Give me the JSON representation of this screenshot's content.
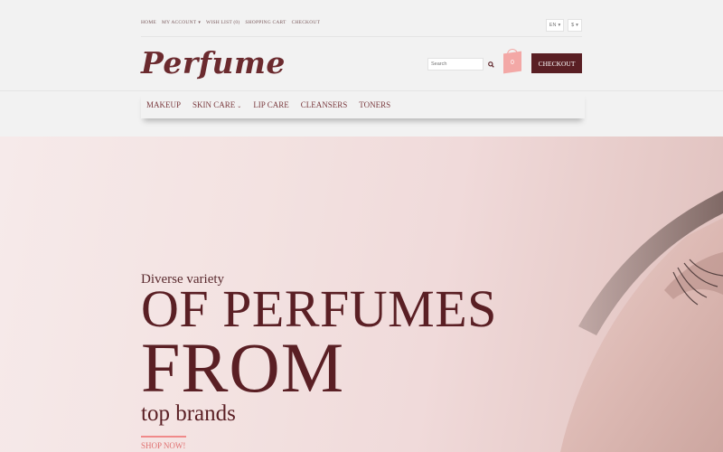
{
  "topbar": {
    "links": [
      "HOME",
      "MY ACCOUNT",
      "WISH LIST (0)",
      "SHOPPING CART",
      "CHECKOUT"
    ],
    "language": "EN",
    "currency": "$"
  },
  "header": {
    "logo": "Perfume",
    "search_placeholder": "Search",
    "cart_count": "0",
    "checkout_label": "CHECKOUT"
  },
  "nav": {
    "items": [
      "MAKEUP",
      "SKIN CARE",
      "LIP CARE",
      "CLEANSERS",
      "TONERS"
    ]
  },
  "hero": {
    "subtitle": "Diverse variety",
    "line1": "OF PERFUMES",
    "line2": "FROM",
    "line3": "top brands",
    "cta": "SHOP NOW!"
  },
  "colors": {
    "brand": "#5a1f24",
    "accent": "#f3a8a6",
    "link": "#e07070"
  },
  "icons": [
    "caret-down-icon",
    "search-icon",
    "cart-icon"
  ]
}
